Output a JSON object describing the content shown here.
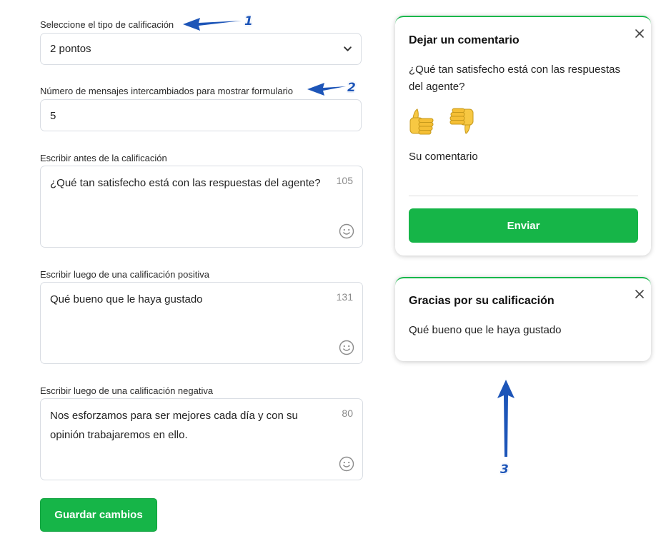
{
  "form": {
    "rating_type_label": "Seleccione el tipo de calificación",
    "rating_type_value": "2 pontos",
    "messages_label": "Número de mensajes intercambiados para mostrar formulario",
    "messages_value": "5",
    "before_label": "Escribir antes de la calificación",
    "before_text": "¿Qué tan satisfecho está con las respuestas del agente?",
    "before_count": "105",
    "positive_label": "Escribir luego de una calificación positiva",
    "positive_text": "Qué bueno que le haya gustado",
    "positive_count": "131",
    "negative_label": "Escribir luego de una calificación negativa",
    "negative_text": "Nos esforzamos para ser mejores cada día y con su opinión trabajaremos en ello.",
    "negative_count": "80",
    "save_label": "Guardar cambios"
  },
  "comment_card": {
    "title": "Dejar un comentario",
    "question": "¿Qué tan satisfecho está con las respuestas del agente?",
    "comment_placeholder": "Su comentario",
    "send_label": "Enviar",
    "icons": [
      "thumbs-up-icon",
      "thumbs-down-icon",
      "close-icon"
    ]
  },
  "thanks_card": {
    "title": "Gracias por su calificación",
    "message": "Qué bueno que le haya gustado"
  },
  "annotations": [
    "1",
    "2",
    "3"
  ],
  "colors": {
    "accent_green": "#16b548",
    "annotation_blue": "#1d55b8",
    "border": "#d9dde3"
  }
}
